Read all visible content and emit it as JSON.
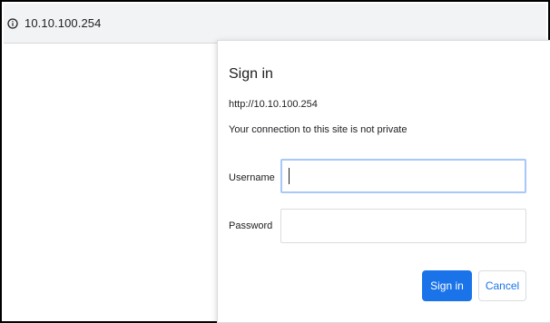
{
  "browser": {
    "address_text": "10.10.100.254",
    "address_icon": "info-circle-icon"
  },
  "dialog": {
    "title": "Sign in",
    "url": "http://10.10.100.254",
    "warning": "Your connection to this site is not private",
    "username_label": "Username",
    "username_value": "",
    "password_label": "Password",
    "password_value": "",
    "signin_label": "Sign in",
    "cancel_label": "Cancel"
  },
  "colors": {
    "accent": "#1a73e8",
    "focus_border": "#a8c7fa",
    "toolbar_bg": "#f1f3f4"
  }
}
